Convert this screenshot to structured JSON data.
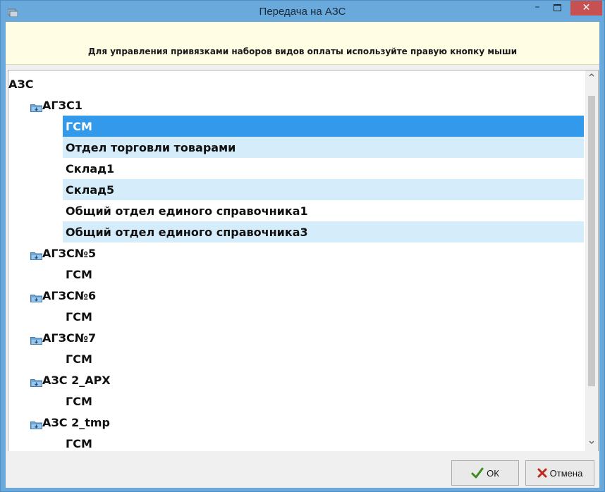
{
  "window": {
    "title": "Передача на АЗС",
    "minimize_glyph": "–",
    "close_glyph": "✕",
    "app_icon": "window-app-icon",
    "title_bar_color": "#6aa9dc",
    "close_button_color": "#c75050"
  },
  "info": {
    "text": "Для управления привязками наборов видов оплаты используйте правую кнопку мыши",
    "background_color": "#fffde3"
  },
  "tree": {
    "root": "АЗС",
    "folder_icon": "folder-icon",
    "selection_color": "#3399ea",
    "alt_row_color": "#d5ecfb",
    "stations": [
      {
        "name": "АГЗС1",
        "children": [
          {
            "label": "ГСМ",
            "selected": true
          },
          {
            "label": "Отдел торговли товарами",
            "highlighted": true
          },
          {
            "label": "Склад1"
          },
          {
            "label": "Склад5",
            "highlighted": true
          },
          {
            "label": "Общий отдел единого справочника1"
          },
          {
            "label": "Общий отдел единого справочника3",
            "highlighted": true
          }
        ]
      },
      {
        "name": "АГЗС№5",
        "children": [
          {
            "label": "ГСМ"
          }
        ]
      },
      {
        "name": "АГЗС№6",
        "children": [
          {
            "label": "ГСМ"
          }
        ]
      },
      {
        "name": "АГЗС№7",
        "children": [
          {
            "label": "ГСМ"
          }
        ]
      },
      {
        "name": "АЗС 2_АРХ",
        "children": [
          {
            "label": "ГСМ"
          }
        ]
      },
      {
        "name": "АЗС 2_tmp",
        "children": [
          {
            "label": "ГСМ"
          }
        ]
      }
    ]
  },
  "buttons": {
    "ok_label": "ОК",
    "ok_icon": "checkmark-icon",
    "cancel_label": "Отмена",
    "cancel_icon": "x-icon"
  }
}
